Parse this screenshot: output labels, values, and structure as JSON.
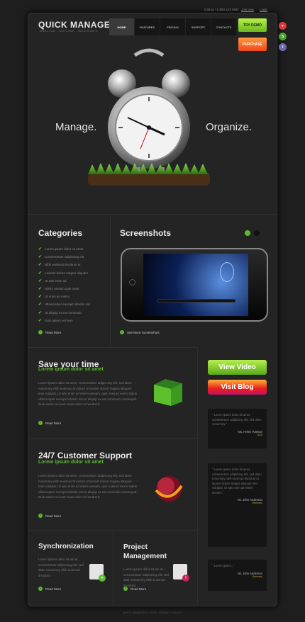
{
  "header": {
    "logo_main": "QUICK MANAGER",
    "logo_tagline": "ANALYZE  .  OUTLINE  .  INTEGRATE",
    "phone": "Call us  +1 800  123 4567",
    "join": "Join now",
    "login": "Login"
  },
  "nav": {
    "items": [
      "HOME",
      "FEATURES",
      "PRICING",
      "SUPPORT",
      "CONTACTS"
    ],
    "active": "HOME"
  },
  "cta": {
    "try_demo": "TRY DEMO",
    "purchase": "PURCHASE"
  },
  "social": [
    "heart-icon",
    "stumbleupon-icon",
    "facebook-icon"
  ],
  "hero": {
    "left": "Manage.",
    "right": "Organize."
  },
  "categories": {
    "title": "Categories",
    "items": [
      "Lorem ipsum dolor sit amet",
      "Consectetuer adipiscing elit",
      "Nibh euismod tincidunt ut",
      "Laoreet dolore magna aliquam",
      "Ut wisi enim ad",
      "Minim veniam quis nostr",
      "Ut enim ad minim",
      "Ullamcorper suscipit lobortis nisl",
      "Ut aliquip ex ea commodo",
      "Duis autem vel eum"
    ],
    "read_more": "Read More"
  },
  "screenshots": {
    "title": "Screenshots",
    "link": "See More Screenshots"
  },
  "save_time": {
    "title": "Save your time",
    "subtitle": "Lorem ipsum dolor sit amet",
    "text": "Lorem ipsum dolor sit amet, consectetuer adipiscing elit, sed diam nonummy nibh euismod tincidunt ut laoreet dolore magna aliquam erat volutpat. Ut wisi enim ad minim veniam, quis nostrud exerci tation ullamcorper suscipit lobortis nisl ut aliquip ex ea commodo consequat. Duis autem vel eum iriure dolor in hendrerit.",
    "read_more": "Read More"
  },
  "support": {
    "title": "24/7 Customer Support",
    "subtitle": "Lorem ipsum dolor sit amet",
    "text": "Lorem ipsum dolor sit amet, consectetuer adipiscing elit, sed diam nonummy nibh euismod tincidunt ut laoreet dolore magna aliquam erat volutpat. Ut wisi enim ad minim veniam, quis nostrud exerci tation ullamcorper suscipit lobortis nisl ut aliquip ex ea commodo consequat. Duis autem vel eum iriure dolor in hendrerit.",
    "read_more": "Read More"
  },
  "sync": {
    "title": "Synchronization",
    "text": "Lorem ipsum dolor sit am et, consectetuer adipiscing elit, sed diam nonummy nibh euismod tincidunt.",
    "read_more": "Read More"
  },
  "project": {
    "title_1": "Project",
    "title_2": "Management",
    "text": "Lorem ipsum dolor sit am et, consectetuer adipiscing elit, sed diam nonummy nibh euismod tincidunt.",
    "read_more": "Read More"
  },
  "buttons": {
    "view_video": "View Video",
    "visit_blog": "Visit Blog"
  },
  "testimonials": [
    {
      "text": "\" Lorem ipsum dolor sit amet, consectetuer adipiscing elit, sed diam nonummy.\"",
      "author": "Ms. Helen Tomson",
      "country": "USA"
    },
    {
      "text": "\" Lorem ipsum dolor sit amet, consectetuer adipiscing elit, sed diam nonummy nibh euismod tincidunt ut laoreet dolore magna aliquam erat volutpat. Ut wisi enim ad minim veniam.\"",
      "author": "Mr. John Anderson",
      "country": "Germany"
    },
    {
      "text": "\" Lorem ipsum...\"",
      "author": "Mr. John Anderson",
      "country": "Germany"
    }
  ],
  "footer": {
    "copyright": "QUICK MANAGER © 2010  |  PRIVACY POLICY"
  },
  "colors": {
    "accent_green": "#5bbd2e",
    "demo_btn": "#8bd42a",
    "purchase_btn": "#ff6a1f",
    "author_gold": "#c6a33b"
  }
}
